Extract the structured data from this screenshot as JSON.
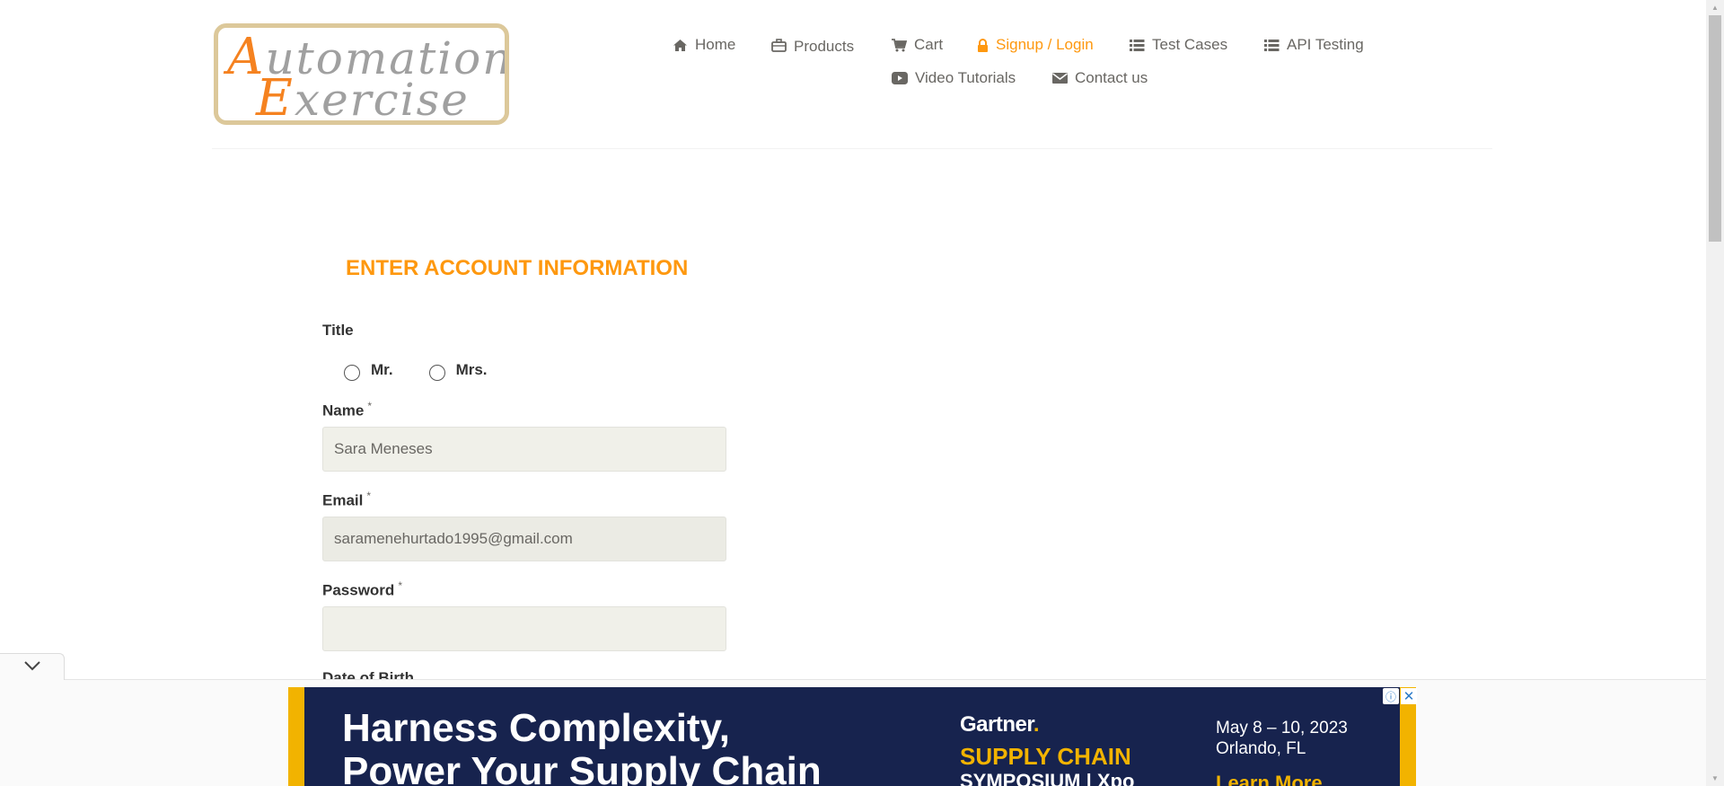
{
  "header": {
    "logo": {
      "line1_cap": "A",
      "line1_rest": "utomation",
      "line2_cap": "E",
      "line2_rest": "xercise"
    },
    "nav": [
      {
        "label": "Home",
        "icon": "home-icon"
      },
      {
        "label": "Products",
        "icon": "briefcase-icon"
      },
      {
        "label": "Cart",
        "icon": "cart-icon"
      },
      {
        "label": "Signup / Login",
        "icon": "lock-icon",
        "active": true
      },
      {
        "label": "Test Cases",
        "icon": "list-icon"
      },
      {
        "label": "API Testing",
        "icon": "list-icon"
      },
      {
        "label": "Video Tutorials",
        "icon": "youtube-play-icon"
      },
      {
        "label": "Contact us",
        "icon": "envelope-icon"
      }
    ],
    "active_color": "#fe980f"
  },
  "form": {
    "heading": "ENTER ACCOUNT INFORMATION",
    "title_label": "Title",
    "title_options": [
      "Mr.",
      "Mrs."
    ],
    "name_label": "Name",
    "name_value": "Sara Meneses",
    "email_label": "Email",
    "email_value": "saramenehurtado1995@gmail.com",
    "password_label": "Password",
    "password_value": "",
    "dob_label": "Date of Birth",
    "required_mark": "*"
  },
  "ad": {
    "headline_line1": "Harness Complexity,",
    "headline_line2": "Power Your Supply Chain",
    "brand": "Gartner",
    "brand_dot": ".",
    "event_line1": "SUPPLY CHAIN",
    "event_line2": "SYMPOSIUM | Xpo",
    "date_line1": "May 8 – 10, 2023",
    "date_line2": "Orlando, FL",
    "cta": "Learn More",
    "info_icon": "info-icon",
    "close_icon": "close-icon",
    "toggle_icon": "chevron-down-icon"
  }
}
